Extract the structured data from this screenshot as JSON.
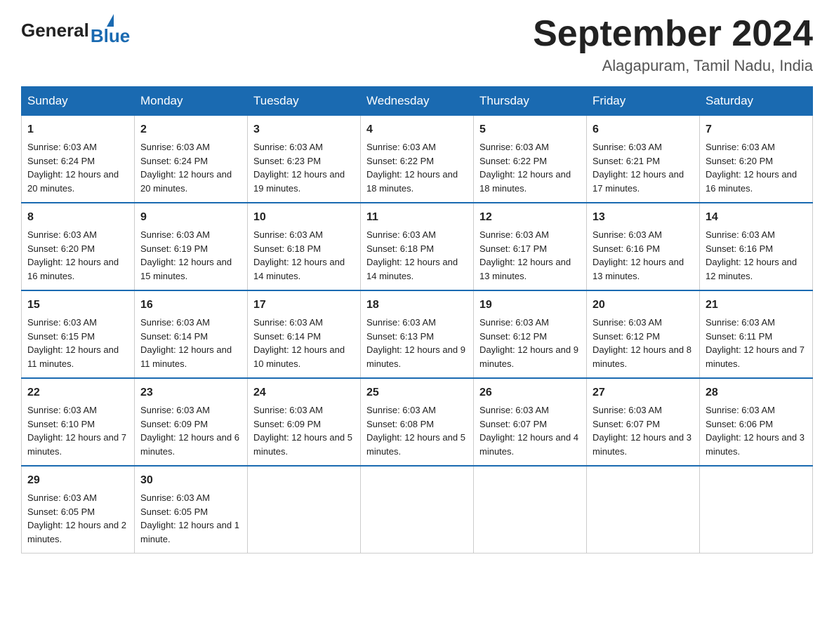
{
  "logo": {
    "general": "General",
    "blue": "Blue"
  },
  "title": "September 2024",
  "subtitle": "Alagapuram, Tamil Nadu, India",
  "days_of_week": [
    "Sunday",
    "Monday",
    "Tuesday",
    "Wednesday",
    "Thursday",
    "Friday",
    "Saturday"
  ],
  "weeks": [
    [
      {
        "day": "1",
        "sunrise": "Sunrise: 6:03 AM",
        "sunset": "Sunset: 6:24 PM",
        "daylight": "Daylight: 12 hours and 20 minutes."
      },
      {
        "day": "2",
        "sunrise": "Sunrise: 6:03 AM",
        "sunset": "Sunset: 6:24 PM",
        "daylight": "Daylight: 12 hours and 20 minutes."
      },
      {
        "day": "3",
        "sunrise": "Sunrise: 6:03 AM",
        "sunset": "Sunset: 6:23 PM",
        "daylight": "Daylight: 12 hours and 19 minutes."
      },
      {
        "day": "4",
        "sunrise": "Sunrise: 6:03 AM",
        "sunset": "Sunset: 6:22 PM",
        "daylight": "Daylight: 12 hours and 18 minutes."
      },
      {
        "day": "5",
        "sunrise": "Sunrise: 6:03 AM",
        "sunset": "Sunset: 6:22 PM",
        "daylight": "Daylight: 12 hours and 18 minutes."
      },
      {
        "day": "6",
        "sunrise": "Sunrise: 6:03 AM",
        "sunset": "Sunset: 6:21 PM",
        "daylight": "Daylight: 12 hours and 17 minutes."
      },
      {
        "day": "7",
        "sunrise": "Sunrise: 6:03 AM",
        "sunset": "Sunset: 6:20 PM",
        "daylight": "Daylight: 12 hours and 16 minutes."
      }
    ],
    [
      {
        "day": "8",
        "sunrise": "Sunrise: 6:03 AM",
        "sunset": "Sunset: 6:20 PM",
        "daylight": "Daylight: 12 hours and 16 minutes."
      },
      {
        "day": "9",
        "sunrise": "Sunrise: 6:03 AM",
        "sunset": "Sunset: 6:19 PM",
        "daylight": "Daylight: 12 hours and 15 minutes."
      },
      {
        "day": "10",
        "sunrise": "Sunrise: 6:03 AM",
        "sunset": "Sunset: 6:18 PM",
        "daylight": "Daylight: 12 hours and 14 minutes."
      },
      {
        "day": "11",
        "sunrise": "Sunrise: 6:03 AM",
        "sunset": "Sunset: 6:18 PM",
        "daylight": "Daylight: 12 hours and 14 minutes."
      },
      {
        "day": "12",
        "sunrise": "Sunrise: 6:03 AM",
        "sunset": "Sunset: 6:17 PM",
        "daylight": "Daylight: 12 hours and 13 minutes."
      },
      {
        "day": "13",
        "sunrise": "Sunrise: 6:03 AM",
        "sunset": "Sunset: 6:16 PM",
        "daylight": "Daylight: 12 hours and 13 minutes."
      },
      {
        "day": "14",
        "sunrise": "Sunrise: 6:03 AM",
        "sunset": "Sunset: 6:16 PM",
        "daylight": "Daylight: 12 hours and 12 minutes."
      }
    ],
    [
      {
        "day": "15",
        "sunrise": "Sunrise: 6:03 AM",
        "sunset": "Sunset: 6:15 PM",
        "daylight": "Daylight: 12 hours and 11 minutes."
      },
      {
        "day": "16",
        "sunrise": "Sunrise: 6:03 AM",
        "sunset": "Sunset: 6:14 PM",
        "daylight": "Daylight: 12 hours and 11 minutes."
      },
      {
        "day": "17",
        "sunrise": "Sunrise: 6:03 AM",
        "sunset": "Sunset: 6:14 PM",
        "daylight": "Daylight: 12 hours and 10 minutes."
      },
      {
        "day": "18",
        "sunrise": "Sunrise: 6:03 AM",
        "sunset": "Sunset: 6:13 PM",
        "daylight": "Daylight: 12 hours and 9 minutes."
      },
      {
        "day": "19",
        "sunrise": "Sunrise: 6:03 AM",
        "sunset": "Sunset: 6:12 PM",
        "daylight": "Daylight: 12 hours and 9 minutes."
      },
      {
        "day": "20",
        "sunrise": "Sunrise: 6:03 AM",
        "sunset": "Sunset: 6:12 PM",
        "daylight": "Daylight: 12 hours and 8 minutes."
      },
      {
        "day": "21",
        "sunrise": "Sunrise: 6:03 AM",
        "sunset": "Sunset: 6:11 PM",
        "daylight": "Daylight: 12 hours and 7 minutes."
      }
    ],
    [
      {
        "day": "22",
        "sunrise": "Sunrise: 6:03 AM",
        "sunset": "Sunset: 6:10 PM",
        "daylight": "Daylight: 12 hours and 7 minutes."
      },
      {
        "day": "23",
        "sunrise": "Sunrise: 6:03 AM",
        "sunset": "Sunset: 6:09 PM",
        "daylight": "Daylight: 12 hours and 6 minutes."
      },
      {
        "day": "24",
        "sunrise": "Sunrise: 6:03 AM",
        "sunset": "Sunset: 6:09 PM",
        "daylight": "Daylight: 12 hours and 5 minutes."
      },
      {
        "day": "25",
        "sunrise": "Sunrise: 6:03 AM",
        "sunset": "Sunset: 6:08 PM",
        "daylight": "Daylight: 12 hours and 5 minutes."
      },
      {
        "day": "26",
        "sunrise": "Sunrise: 6:03 AM",
        "sunset": "Sunset: 6:07 PM",
        "daylight": "Daylight: 12 hours and 4 minutes."
      },
      {
        "day": "27",
        "sunrise": "Sunrise: 6:03 AM",
        "sunset": "Sunset: 6:07 PM",
        "daylight": "Daylight: 12 hours and 3 minutes."
      },
      {
        "day": "28",
        "sunrise": "Sunrise: 6:03 AM",
        "sunset": "Sunset: 6:06 PM",
        "daylight": "Daylight: 12 hours and 3 minutes."
      }
    ],
    [
      {
        "day": "29",
        "sunrise": "Sunrise: 6:03 AM",
        "sunset": "Sunset: 6:05 PM",
        "daylight": "Daylight: 12 hours and 2 minutes."
      },
      {
        "day": "30",
        "sunrise": "Sunrise: 6:03 AM",
        "sunset": "Sunset: 6:05 PM",
        "daylight": "Daylight: 12 hours and 1 minute."
      },
      null,
      null,
      null,
      null,
      null
    ]
  ]
}
